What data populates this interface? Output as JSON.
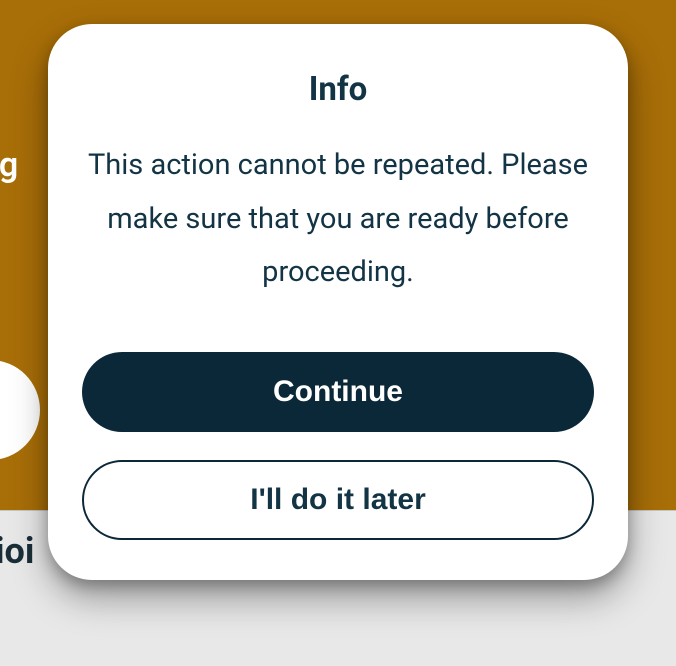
{
  "background": {
    "partial_text_1": "ig",
    "partial_text_2": "ioi"
  },
  "dialog": {
    "title": "Info",
    "body": "This action cannot be repeated. Please make sure that you are ready before proceeding.",
    "primary_label": "Continue",
    "secondary_label": "I'll do it later"
  }
}
